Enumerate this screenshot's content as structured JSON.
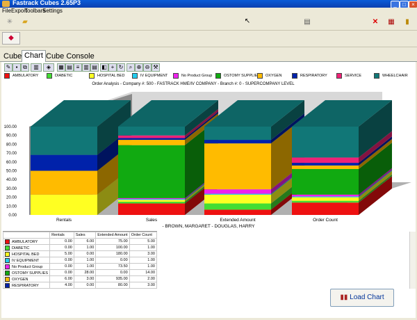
{
  "window": {
    "title": "Fastrack Cubes 2.65P3"
  },
  "menu": [
    "File",
    "Export",
    "Toolbars",
    "Settings"
  ],
  "tabs": [
    {
      "label": "Cube"
    },
    {
      "label": "Chart"
    },
    {
      "label": "Cube Console"
    }
  ],
  "active_tab": "Chart",
  "legend": [
    {
      "name": "AMBULATORY",
      "color": "#ee1111"
    },
    {
      "name": "DIABETIC",
      "color": "#44dd33"
    },
    {
      "name": "HOSPITAL BED",
      "color": "#ffff22"
    },
    {
      "name": "IV EQUIPMENT",
      "color": "#22ccee"
    },
    {
      "name": "No Product Group",
      "color": "#ee22ee"
    },
    {
      "name": "OSTOMY SUPPLIES",
      "color": "#11aa11"
    },
    {
      "name": "OXYGEN",
      "color": "#ffbb00"
    },
    {
      "name": "RESPIRATORY",
      "color": "#0022aa"
    },
    {
      "name": "SERVICE",
      "color": "#ee2277"
    },
    {
      "name": "WHEELCHAIR",
      "color": "#117777"
    }
  ],
  "chart_data": {
    "type": "bar",
    "title": "Order Analysis -  Company #: 500 - FASTRACK HME/IV COMPANY        -  Branch #: 0 - SUPERCOMPANY LEVEL",
    "subtitle": "- BROWN, MARGARET - DOUGLAS, HARRY",
    "categories": [
      "Rentals",
      "Sales",
      "Extended Amount",
      "Order Count"
    ],
    "ylim": [
      0,
      100
    ],
    "yticks": [
      "0.00",
      "10.00",
      "20.00",
      "30.00",
      "40.00",
      "50.00",
      "60.00",
      "70.00",
      "80.00",
      "90.00",
      "100.00"
    ],
    "stacked_percent": true,
    "series": [
      {
        "name": "AMBULATORY",
        "values": [
          0,
          13,
          6,
          14
        ]
      },
      {
        "name": "DIABETIC",
        "values": [
          0,
          2,
          7,
          2
        ]
      },
      {
        "name": "HOSPITAL BED",
        "values": [
          23,
          2,
          10,
          4
        ]
      },
      {
        "name": "IV EQUIPMENT",
        "values": [
          0,
          1,
          1,
          1
        ]
      },
      {
        "name": "No Product Group",
        "values": [
          0,
          1,
          5,
          2
        ]
      },
      {
        "name": "OSTOMY SUPPLIES",
        "values": [
          0,
          60,
          0,
          29
        ]
      },
      {
        "name": "OXYGEN",
        "values": [
          27,
          6,
          52,
          4
        ]
      },
      {
        "name": "RESPIRATORY",
        "values": [
          18,
          2,
          4,
          3
        ]
      },
      {
        "name": "SERVICE",
        "values": [
          0,
          3,
          0,
          6
        ]
      },
      {
        "name": "WHEELCHAIR",
        "values": [
          32,
          10,
          15,
          35
        ]
      }
    ]
  },
  "table": {
    "headers": [
      "",
      "Rentals",
      "Sales",
      "Extended Amount",
      "Order Count"
    ],
    "rows": [
      {
        "name": "AMBULATORY",
        "color": "#ee1111",
        "cells": [
          "0.00",
          "6.00",
          "75.00",
          "5.00"
        ]
      },
      {
        "name": "DIABETIC",
        "color": "#44dd33",
        "cells": [
          "0.00",
          "1.00",
          "100.00",
          "1.00"
        ]
      },
      {
        "name": "HOSPITAL BED",
        "color": "#ffff22",
        "cells": [
          "5.00",
          "0.00",
          "180.00",
          "3.00"
        ]
      },
      {
        "name": "IV EQUIPMENT",
        "color": "#22ccee",
        "cells": [
          "0.00",
          "1.00",
          "0.00",
          "1.00"
        ]
      },
      {
        "name": "No Product Group",
        "color": "#ee22ee",
        "cells": [
          "0.00",
          "1.00",
          "73.50",
          "1.00"
        ]
      },
      {
        "name": "OSTOMY SUPPLIES",
        "color": "#11aa11",
        "cells": [
          "0.00",
          "28.00",
          "0.00",
          "14.00"
        ]
      },
      {
        "name": "OXYGEN",
        "color": "#ffbb00",
        "cells": [
          "6.00",
          "3.00",
          "935.00",
          "2.00"
        ]
      },
      {
        "name": "RESPIRATORY",
        "color": "#0022aa",
        "cells": [
          "4.00",
          "0.00",
          "80.00",
          "3.00"
        ]
      }
    ]
  },
  "load_button": {
    "label": "Load Chart"
  }
}
